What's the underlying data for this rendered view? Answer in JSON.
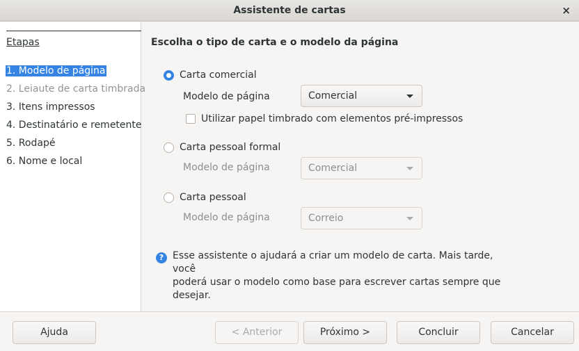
{
  "window": {
    "title": "Assistente de cartas",
    "close_glyph": "×"
  },
  "sidebar": {
    "header": "Etapas",
    "steps": [
      {
        "label": "1. Modelo de página",
        "state": "selected"
      },
      {
        "label": "2. Leiaute de carta timbrada",
        "state": "disabled"
      },
      {
        "label": "3. Itens impressos",
        "state": "normal"
      },
      {
        "label": "4. Destinatário e remetente",
        "state": "normal"
      },
      {
        "label": "5. Rodapé",
        "state": "normal"
      },
      {
        "label": "6. Nome e local",
        "state": "normal"
      }
    ]
  },
  "main": {
    "title": "Escolha o tipo de carta e o modelo da página",
    "options": [
      {
        "label": "Carta comercial",
        "checked": true,
        "field_label": "Modelo de página",
        "dropdown": "Comercial",
        "enabled": true
      },
      {
        "label": "Carta pessoal formal",
        "checked": false,
        "field_label": "Modelo de página",
        "dropdown": "Comercial",
        "enabled": false
      },
      {
        "label": "Carta pessoal",
        "checked": false,
        "field_label": "Modelo de página",
        "dropdown": "Correio",
        "enabled": false
      }
    ],
    "letterhead_checkbox": {
      "label": "Utilizar papel timbrado com elementos pré-impressos",
      "checked": false
    },
    "info": {
      "icon": "question-icon",
      "glyph": "?",
      "lines": [
        "Esse assistente o ajudará a criar um modelo de carta. Mais tarde, você",
        "poderá usar o modelo como base para escrever cartas sempre que",
        "desejar."
      ]
    }
  },
  "footer": {
    "help": "Ajuda",
    "back": "< Anterior",
    "next": "Próximo >",
    "finish": "Concluir",
    "cancel": "Cancelar"
  },
  "colors": {
    "accent": "#3584e4",
    "disabled_text": "#929595"
  }
}
